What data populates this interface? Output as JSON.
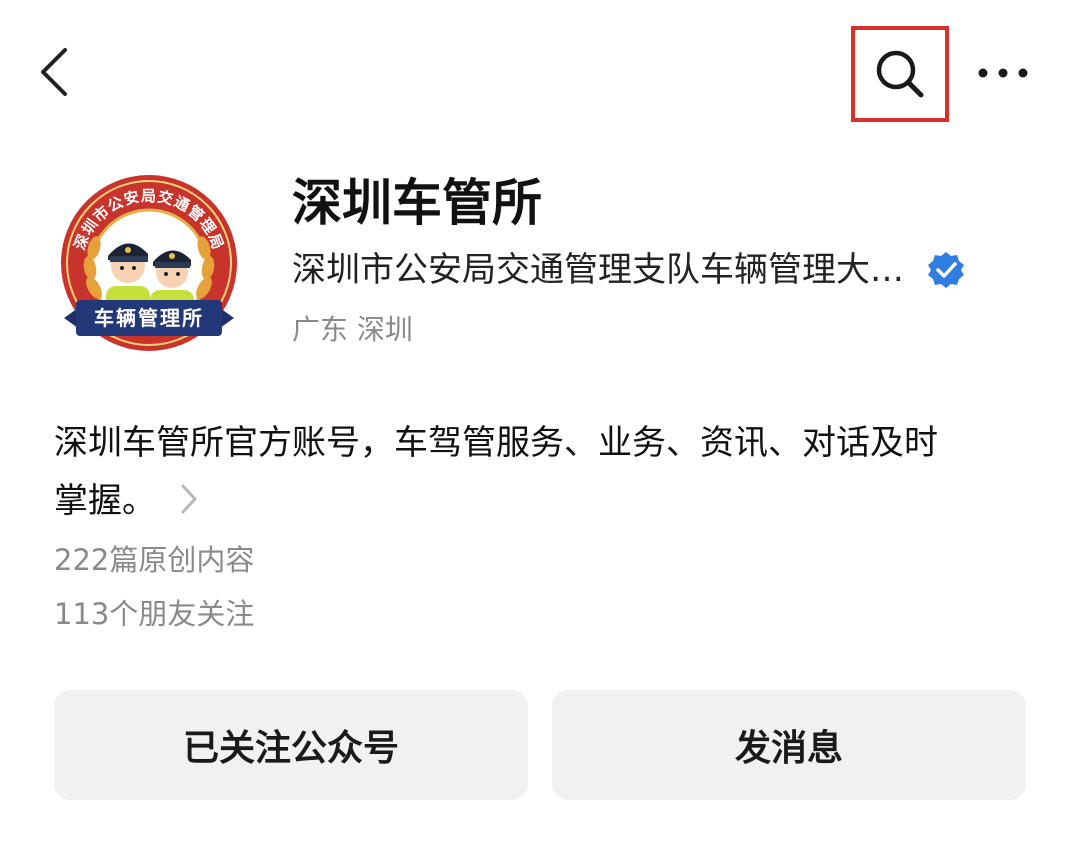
{
  "topbar": {
    "back_icon": "chevron-left-icon",
    "search_icon": "search-icon",
    "more_icon": "more-horizontal-icon",
    "highlight_color": "#d9302c"
  },
  "profile": {
    "name": "深圳车管所",
    "entity": "深圳市公安局交通管理支队车辆管理大…",
    "verified_icon": "verified-badge-icon",
    "verified_color": "#2f7de1",
    "location": "广东 深圳",
    "avatar": {
      "ring_text": "深圳市公安局交通管理局",
      "banner_text": "车辆管理所"
    }
  },
  "description": {
    "line1": "深圳车管所官方账号，车驾管服务、业务、资讯、对话及时",
    "line2": "掌握。"
  },
  "stats": {
    "articles": "222篇原创内容",
    "friends": "113个朋友关注"
  },
  "actions": {
    "follow_label": "已关注公众号",
    "message_label": "发消息"
  }
}
